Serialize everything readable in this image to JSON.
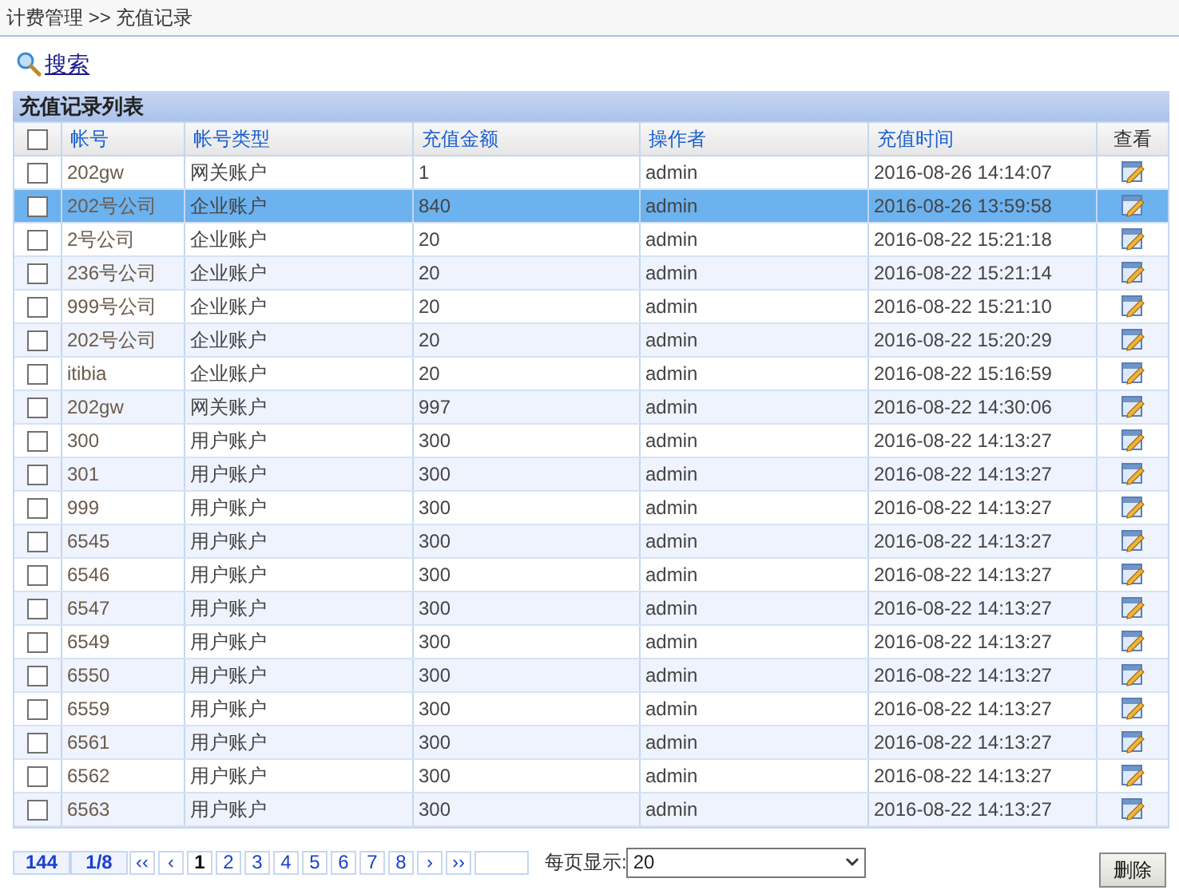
{
  "breadcrumb": "计费管理 >> 充值记录",
  "search_link": "搜索",
  "panel_title": "充值记录列表",
  "table": {
    "select_all_checked": false,
    "columns": [
      "帐号",
      "帐号类型",
      "充值金额",
      "操作者",
      "充值时间",
      "查看"
    ],
    "rows": [
      {
        "selected": false,
        "checked": false,
        "cells": [
          "202gw",
          "网关账户",
          "1",
          "admin",
          "2016-08-26 14:14:07"
        ]
      },
      {
        "selected": true,
        "checked": false,
        "cells": [
          "202号公司",
          "企业账户",
          "840",
          "admin",
          "2016-08-26 13:59:58"
        ]
      },
      {
        "selected": false,
        "checked": false,
        "cells": [
          "2号公司",
          "企业账户",
          "20",
          "admin",
          "2016-08-22 15:21:18"
        ]
      },
      {
        "selected": false,
        "checked": false,
        "cells": [
          "236号公司",
          "企业账户",
          "20",
          "admin",
          "2016-08-22 15:21:14"
        ]
      },
      {
        "selected": false,
        "checked": false,
        "cells": [
          "999号公司",
          "企业账户",
          "20",
          "admin",
          "2016-08-22 15:21:10"
        ]
      },
      {
        "selected": false,
        "checked": false,
        "cells": [
          "202号公司",
          "企业账户",
          "20",
          "admin",
          "2016-08-22 15:20:29"
        ]
      },
      {
        "selected": false,
        "checked": false,
        "cells": [
          "itibia",
          "企业账户",
          "20",
          "admin",
          "2016-08-22 15:16:59"
        ]
      },
      {
        "selected": false,
        "checked": false,
        "cells": [
          "202gw",
          "网关账户",
          "997",
          "admin",
          "2016-08-22 14:30:06"
        ]
      },
      {
        "selected": false,
        "checked": false,
        "cells": [
          "300",
          "用户账户",
          "300",
          "admin",
          "2016-08-22 14:13:27"
        ]
      },
      {
        "selected": false,
        "checked": false,
        "cells": [
          "301",
          "用户账户",
          "300",
          "admin",
          "2016-08-22 14:13:27"
        ]
      },
      {
        "selected": false,
        "checked": false,
        "cells": [
          "999",
          "用户账户",
          "300",
          "admin",
          "2016-08-22 14:13:27"
        ]
      },
      {
        "selected": false,
        "checked": false,
        "cells": [
          "6545",
          "用户账户",
          "300",
          "admin",
          "2016-08-22 14:13:27"
        ]
      },
      {
        "selected": false,
        "checked": false,
        "cells": [
          "6546",
          "用户账户",
          "300",
          "admin",
          "2016-08-22 14:13:27"
        ]
      },
      {
        "selected": false,
        "checked": false,
        "cells": [
          "6547",
          "用户账户",
          "300",
          "admin",
          "2016-08-22 14:13:27"
        ]
      },
      {
        "selected": false,
        "checked": false,
        "cells": [
          "6549",
          "用户账户",
          "300",
          "admin",
          "2016-08-22 14:13:27"
        ]
      },
      {
        "selected": false,
        "checked": false,
        "cells": [
          "6550",
          "用户账户",
          "300",
          "admin",
          "2016-08-22 14:13:27"
        ]
      },
      {
        "selected": false,
        "checked": false,
        "cells": [
          "6559",
          "用户账户",
          "300",
          "admin",
          "2016-08-22 14:13:27"
        ]
      },
      {
        "selected": false,
        "checked": false,
        "cells": [
          "6561",
          "用户账户",
          "300",
          "admin",
          "2016-08-22 14:13:27"
        ]
      },
      {
        "selected": false,
        "checked": false,
        "cells": [
          "6562",
          "用户账户",
          "300",
          "admin",
          "2016-08-22 14:13:27"
        ]
      },
      {
        "selected": false,
        "checked": false,
        "cells": [
          "6563",
          "用户账户",
          "300",
          "admin",
          "2016-08-22 14:13:27"
        ]
      }
    ]
  },
  "pager": {
    "total": "144",
    "page_of": "1/8",
    "buttons": [
      {
        "label": "‹‹",
        "selected": false
      },
      {
        "label": "‹",
        "selected": false
      },
      {
        "label": "1",
        "selected": true
      },
      {
        "label": "2",
        "selected": false
      },
      {
        "label": "3",
        "selected": false
      },
      {
        "label": "4",
        "selected": false
      },
      {
        "label": "5",
        "selected": false
      },
      {
        "label": "6",
        "selected": false
      },
      {
        "label": "7",
        "selected": false
      },
      {
        "label": "8",
        "selected": false
      },
      {
        "label": "›",
        "selected": false
      },
      {
        "label": "››",
        "selected": false
      }
    ],
    "page_size_label": "每页显示:",
    "page_size": "20"
  },
  "delete_button": "删除"
}
